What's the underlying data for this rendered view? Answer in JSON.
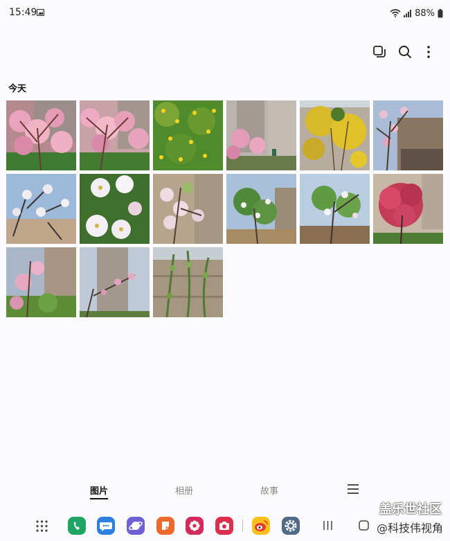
{
  "status": {
    "time": "15:49",
    "battery": "88%"
  },
  "toolbar": {
    "icons": [
      "select-icon",
      "search-icon",
      "more-options-icon"
    ]
  },
  "section": {
    "title": "今天"
  },
  "photos": [
    {
      "subject": "pink-blossom"
    },
    {
      "subject": "pink-blossom"
    },
    {
      "subject": "yellow-flowers"
    },
    {
      "subject": "pink-blossom-building"
    },
    {
      "subject": "forsythia"
    },
    {
      "subject": "magnolia-building"
    },
    {
      "subject": "white-blossom-sky"
    },
    {
      "subject": "white-blossom-closeup"
    },
    {
      "subject": "pink-white-blossom"
    },
    {
      "subject": "white-blossom-tree"
    },
    {
      "subject": "white-blossom-tree"
    },
    {
      "subject": "red-tree-building"
    },
    {
      "subject": "pink-blossom-building"
    },
    {
      "subject": "peach-branch-building"
    },
    {
      "subject": "vines-wall"
    }
  ],
  "tabs": {
    "pictures": "图片",
    "albums": "相册",
    "stories": "故事"
  },
  "dock": {
    "apps": [
      "apps-grid-icon",
      "phone-icon",
      "messages-icon",
      "internet-icon",
      "notes-icon",
      "bixby-icon",
      "camera-icon",
      "weibo-icon",
      "settings-icon"
    ]
  },
  "watermark": {
    "line1": "盖乐世社区",
    "line2": "@科技伟视角"
  },
  "colors": {
    "background": "#fbfbfd",
    "active_tab": "#111111",
    "inactive_tab": "#8a8a8a"
  }
}
